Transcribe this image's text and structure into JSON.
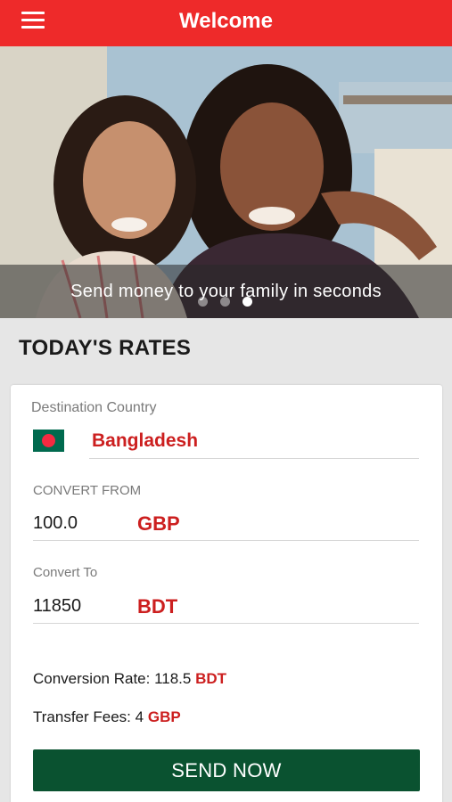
{
  "header": {
    "title": "Welcome",
    "menu_icon": "hamburger-menu-icon"
  },
  "hero": {
    "caption": "Send money to your family in seconds",
    "slide_count": 3,
    "active_slide": 3
  },
  "rates": {
    "title": "TODAY'S RATES",
    "destination": {
      "label": "Destination Country",
      "country": "Bangladesh",
      "flag_icon": "bangladesh-flag-icon"
    },
    "convert_from": {
      "label": "CONVERT FROM",
      "amount": "100.0",
      "currency": "GBP"
    },
    "convert_to": {
      "label": "Convert To",
      "amount": "11850",
      "currency": "BDT"
    },
    "conversion_rate": {
      "label": "Conversion Rate:",
      "value": "118.5",
      "currency": "BDT"
    },
    "transfer_fees": {
      "label": "Transfer Fees:",
      "value": "4",
      "currency": "GBP"
    },
    "send_button": "SEND NOW"
  },
  "colors": {
    "accent_red": "#ee2a2a",
    "currency_red": "#cc1f1f",
    "button_green": "#0a5230"
  }
}
